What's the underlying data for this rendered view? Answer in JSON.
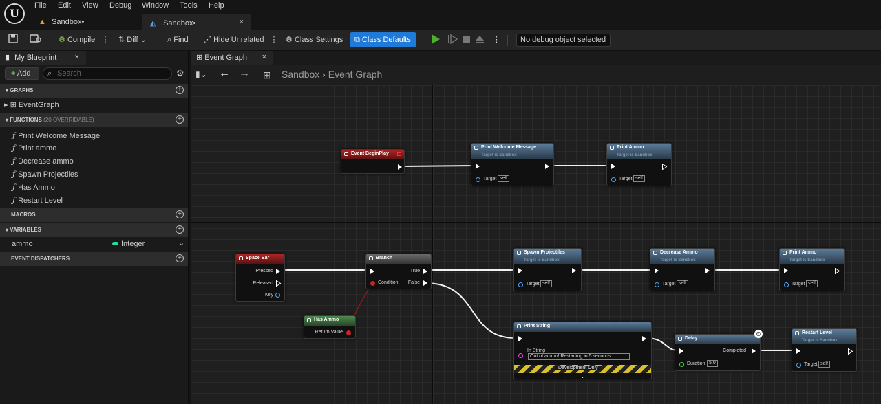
{
  "app": {
    "logo_text": "U"
  },
  "menu": [
    "File",
    "Edit",
    "View",
    "Debug",
    "Window",
    "Tools",
    "Help"
  ],
  "doc_tabs": [
    {
      "label": "Sandbox•"
    },
    {
      "label": "Sandbox•",
      "close": "×"
    }
  ],
  "toolbar": {
    "compile": "Compile",
    "diff": "Diff",
    "find": "Find",
    "hide_unrelated": "Hide Unrelated",
    "class_settings": "Class Settings",
    "class_defaults": "Class Defaults",
    "debug_object": "No debug object selected"
  },
  "my_blueprint": {
    "tab_label": "My Blueprint",
    "close": "×",
    "add_label": "Add",
    "search_placeholder": "Search",
    "sections": {
      "graphs": "GRAPHS",
      "functions": "FUNCTIONS",
      "functions_note": "(20 OVERRIDABLE)",
      "macros": "MACROS",
      "variables": "VARIABLES",
      "event_dispatchers": "EVENT DISPATCHERS"
    },
    "graphs": [
      "EventGraph"
    ],
    "functions": [
      "Print Welcome Message",
      "Print ammo",
      "Decrease ammo",
      "Spawn Projectiles",
      "Has Ammo",
      "Restart Level"
    ],
    "variables": [
      {
        "name": "ammo",
        "type": "Integer",
        "type_color": "#1fe0a0"
      }
    ]
  },
  "graph": {
    "tab_label": "Event Graph",
    "breadcrumb_root": "Sandbox",
    "breadcrumb_sep": "›",
    "breadcrumb_leaf": "Event Graph",
    "nodes": {
      "begin_play": {
        "title": "Event BeginPlay"
      },
      "print_welcome": {
        "title": "Print Welcome Message",
        "subtitle": "Target is Sandbox",
        "pin_target": "Target",
        "self": "self"
      },
      "print_ammo_1": {
        "title": "Print Ammo",
        "subtitle": "Target is Sandbox",
        "pin_target": "Target",
        "self": "self"
      },
      "space_bar": {
        "title": "Space Bar",
        "pressed": "Pressed",
        "released": "Released",
        "key": "Key"
      },
      "branch": {
        "title": "Branch",
        "condition": "Condition",
        "true": "True",
        "false": "False"
      },
      "has_ammo": {
        "title": "Has Ammo",
        "return_value": "Return Value"
      },
      "spawn_projectiles": {
        "title": "Spawn Projectiles",
        "subtitle": "Target is Sandbox",
        "pin_target": "Target",
        "self": "self"
      },
      "decrease_ammo": {
        "title": "Decrease Ammo",
        "subtitle": "Target is Sandbox",
        "pin_target": "Target",
        "self": "self"
      },
      "print_ammo_2": {
        "title": "Print Ammo",
        "subtitle": "Target is Sandbox",
        "pin_target": "Target",
        "self": "self"
      },
      "print_string": {
        "title": "Print String",
        "in_string_label": "In String",
        "in_string_value": "Out of ammo! Restarting in 5 seconds...",
        "dev_only": "Development Only"
      },
      "delay": {
        "title": "Delay",
        "completed": "Completed",
        "duration_label": "Duration",
        "duration_value": "5.0"
      },
      "restart_level": {
        "title": "Restart Level",
        "subtitle": "Target is Sandbox",
        "pin_target": "Target",
        "self": "self"
      }
    }
  }
}
